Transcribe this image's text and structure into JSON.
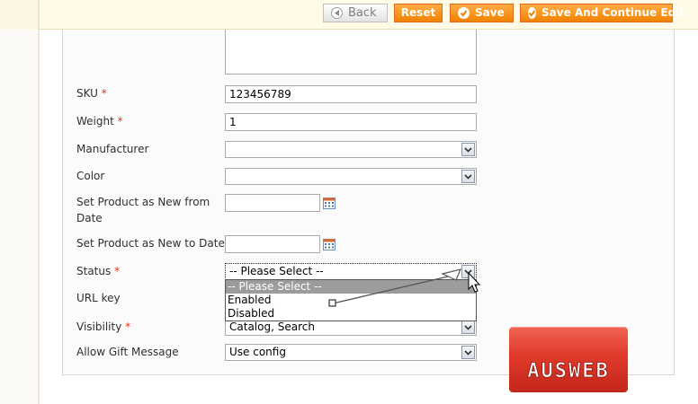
{
  "toolbar": {
    "back_label": "Back",
    "reset_label": "Reset",
    "save_label": "Save",
    "save_continue_label": "Save And Continue Edit"
  },
  "form": {
    "sku": {
      "label": "SKU",
      "required_mark": "*",
      "value": "123456789"
    },
    "weight": {
      "label": "Weight",
      "required_mark": "*",
      "value": "1"
    },
    "manufacturer": {
      "label": "Manufacturer",
      "value": ""
    },
    "color": {
      "label": "Color",
      "value": ""
    },
    "new_from": {
      "label_line1": "Set Product as New from",
      "label_line2": "Date",
      "value": ""
    },
    "new_to": {
      "label": "Set Product as New to Date",
      "value": ""
    },
    "status": {
      "label": "Status",
      "required_mark": "*",
      "selected": "-- Please Select --",
      "options": [
        "-- Please Select --",
        "Enabled",
        "Disabled"
      ]
    },
    "url_key": {
      "label": "URL key"
    },
    "visibility": {
      "label": "Visibility",
      "required_mark": "*",
      "value": "Catalog, Search"
    },
    "gift_message": {
      "label": "Allow Gift Message",
      "value": "Use config"
    }
  },
  "logo": {
    "text": "AUSWEB"
  },
  "colors": {
    "button_orange": "#f18200",
    "required": "#eb340a",
    "logo_red": "#e03a2b"
  }
}
